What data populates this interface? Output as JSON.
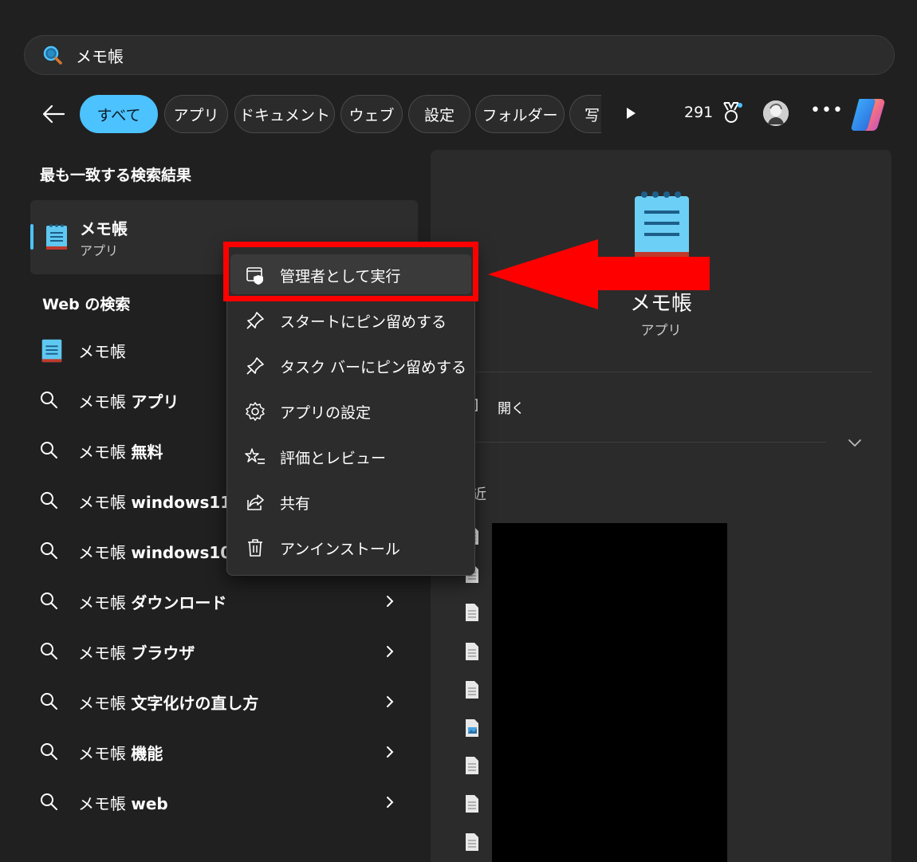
{
  "search": {
    "query": "メモ帳"
  },
  "filters": {
    "chips": [
      "すべて",
      "アプリ",
      "ドキュメント",
      "ウェブ",
      "設定",
      "フォルダー",
      "写"
    ],
    "active_index": 0
  },
  "header": {
    "points": "291"
  },
  "best_match": {
    "section_title": "最も一致する検索結果",
    "name": "メモ帳",
    "type": "アプリ"
  },
  "web_search": {
    "section_title": "Web の検索",
    "items": [
      {
        "prefix": "メモ帳",
        "bold": ""
      },
      {
        "prefix": "メモ帳 ",
        "bold": "アプリ"
      },
      {
        "prefix": "メモ帳 ",
        "bold": "無料"
      },
      {
        "prefix": "メモ帳 ",
        "bold": "windows11"
      },
      {
        "prefix": "メモ帳 ",
        "bold": "windows10"
      },
      {
        "prefix": "メモ帳 ",
        "bold": "ダウンロード"
      },
      {
        "prefix": "メモ帳 ",
        "bold": "ブラウザ"
      },
      {
        "prefix": "メモ帳 ",
        "bold": "文字化けの直し方"
      },
      {
        "prefix": "メモ帳 ",
        "bold": "機能"
      },
      {
        "prefix": "メモ帳 ",
        "bold": "web"
      }
    ]
  },
  "context_menu": {
    "items": [
      {
        "label": "管理者として実行",
        "icon": "shield-icon"
      },
      {
        "label": "スタートにピン留めする",
        "icon": "pin-icon"
      },
      {
        "label": "タスク バーにピン留めする",
        "icon": "pin-icon"
      },
      {
        "label": "アプリの設定",
        "icon": "gear-icon"
      },
      {
        "label": "評価とレビュー",
        "icon": "star-list-icon"
      },
      {
        "label": "共有",
        "icon": "share-icon"
      },
      {
        "label": "アンインストール",
        "icon": "trash-icon"
      }
    ]
  },
  "preview": {
    "name": "メモ帳",
    "type": "アプリ",
    "open_label": "開く",
    "recent_label": "近"
  },
  "colors": {
    "accent": "#4cc2ff",
    "background": "#202020",
    "highlight": "#ff0000"
  }
}
